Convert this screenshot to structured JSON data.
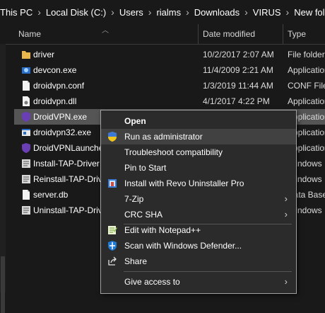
{
  "breadcrumb": [
    "This PC",
    "Local Disk (C:)",
    "Users",
    "rialms",
    "Downloads",
    "VIRUS",
    "New folder"
  ],
  "columns": {
    "name": "Name",
    "date": "Date modified",
    "type": "Type"
  },
  "files": [
    {
      "name": "driver",
      "date": "10/2/2017 2:07 AM",
      "type": "File folder",
      "icon": "folder-icon"
    },
    {
      "name": "devcon.exe",
      "date": "11/4/2009 2:21 AM",
      "type": "Application",
      "icon": "app-icon"
    },
    {
      "name": "droidvpn.conf",
      "date": "1/3/2019 11:44 AM",
      "type": "CONF File",
      "icon": "file-icon"
    },
    {
      "name": "droidvpn.dll",
      "date": "4/1/2017 4:22 PM",
      "type": "Application",
      "icon": "dll-icon"
    },
    {
      "name": "DroidVPN.exe",
      "date": "",
      "type": "Application",
      "icon": "shield-app-icon"
    },
    {
      "name": "droidvpn32.exe",
      "date": "",
      "type": "Application",
      "icon": "window-app-icon"
    },
    {
      "name": "DroidVPNLauncher",
      "date": "",
      "type": "Application",
      "icon": "shield-app-icon"
    },
    {
      "name": "Install-TAP-Driver",
      "date": "",
      "type": "Windows",
      "icon": "script-icon"
    },
    {
      "name": "Reinstall-TAP-Driv",
      "date": "",
      "type": "Windows",
      "icon": "script-icon"
    },
    {
      "name": "server.db",
      "date": "",
      "type": "Data Base",
      "icon": "file-icon"
    },
    {
      "name": "Uninstall-TAP-Driv",
      "date": "",
      "type": "Windows",
      "icon": "script-icon"
    }
  ],
  "menu": {
    "open": "Open",
    "run_admin": "Run as administrator",
    "troubleshoot": "Troubleshoot compatibility",
    "pin_start": "Pin to Start",
    "revo": "Install with Revo Uninstaller Pro",
    "zip": "7-Zip",
    "crc": "CRC SHA",
    "notepad": "Edit with Notepad++",
    "defender": "Scan with Windows Defender...",
    "share": "Share",
    "give_access": "Give access to"
  },
  "colors": {
    "background": "#191919",
    "selected_row": "#555555",
    "menu_bg": "#2b2b2b",
    "folder": "#e8b84a"
  }
}
